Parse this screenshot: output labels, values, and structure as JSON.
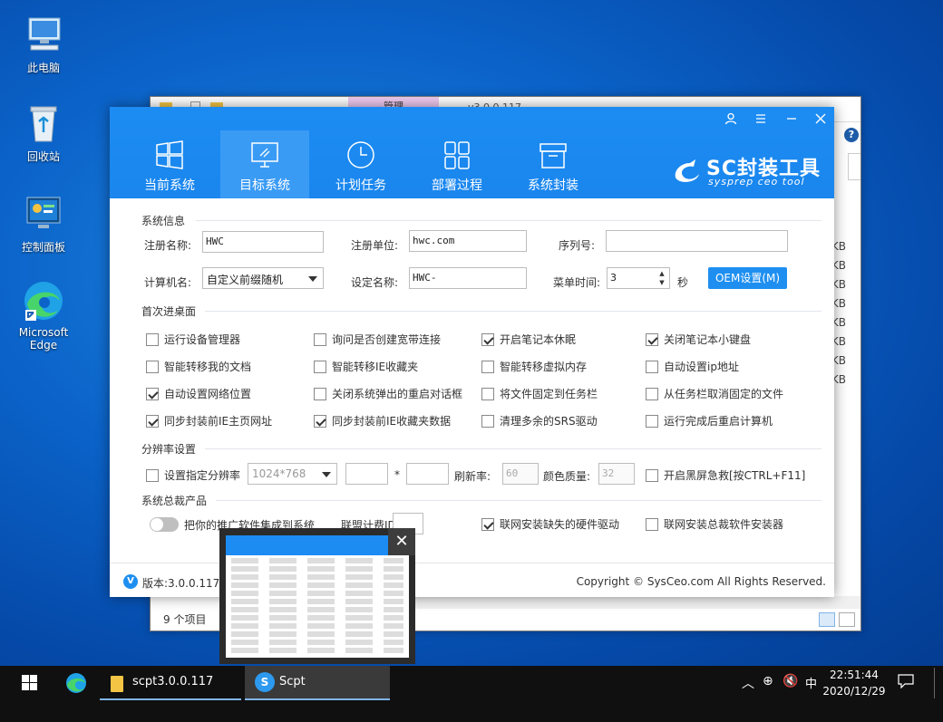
{
  "desktop": {
    "icons": [
      {
        "label": "此电脑"
      },
      {
        "label": "回收站"
      },
      {
        "label": "控制面板"
      },
      {
        "label": "Microsoft Edge"
      }
    ]
  },
  "explorer": {
    "manage_tab": "管理",
    "version": "v3.0.0.117",
    "help": "?",
    "size_unit": "KB",
    "status": "9 个项目"
  },
  "app": {
    "tabs": [
      {
        "label": "当前系统",
        "icon": "windows-logo-icon"
      },
      {
        "label": "目标系统",
        "icon": "monitor-icon",
        "active": true
      },
      {
        "label": "计划任务",
        "icon": "clock-icon"
      },
      {
        "label": "部署过程",
        "icon": "grid-icon"
      },
      {
        "label": "系统封装",
        "icon": "package-icon"
      }
    ],
    "brand": {
      "title": "SC封装工具",
      "subtitle": "sysprep ceo tool"
    },
    "sections": {
      "system_info": "系统信息",
      "first_desktop": "首次进桌面",
      "resolution": "分辨率设置",
      "products": "系统总裁产品"
    },
    "system_info": {
      "reg_name_label": "注册名称:",
      "reg_name_value": "HWC",
      "reg_org_label": "注册单位:",
      "reg_org_value": "hwc.com",
      "serial_label": "序列号:",
      "serial_value": "",
      "computer_name_label": "计算机名:",
      "computer_name_value": "自定义前缀随机",
      "set_name_label": "设定名称:",
      "set_name_value": "HWC-",
      "menu_time_label": "菜单时间:",
      "menu_time_value": "3",
      "menu_time_unit": "秒",
      "oem_button": "OEM设置(M)"
    },
    "first_desktop_options": [
      {
        "label": "运行设备管理器",
        "checked": false
      },
      {
        "label": "询问是否创建宽带连接",
        "checked": false
      },
      {
        "label": "开启笔记本休眠",
        "checked": true
      },
      {
        "label": "关闭笔记本小键盘",
        "checked": true
      },
      {
        "label": "智能转移我的文档",
        "checked": false
      },
      {
        "label": "智能转移IE收藏夹",
        "checked": false
      },
      {
        "label": "智能转移虚拟内存",
        "checked": false
      },
      {
        "label": "自动设置ip地址",
        "checked": false
      },
      {
        "label": "自动设置网络位置",
        "checked": true
      },
      {
        "label": "关闭系统弹出的重启对话框",
        "checked": false
      },
      {
        "label": "将文件固定到任务栏",
        "checked": false
      },
      {
        "label": "从任务栏取消固定的文件",
        "checked": false
      },
      {
        "label": "同步封装前IE主页网址",
        "checked": true
      },
      {
        "label": "同步封装前IE收藏夹数据",
        "checked": true
      },
      {
        "label": "清理多余的SRS驱动",
        "checked": false
      },
      {
        "label": "运行完成后重启计算机",
        "checked": false
      }
    ],
    "resolution": {
      "set_label": "设置指定分辨率",
      "set_checked": false,
      "resolution_value": "1024*768",
      "times": "*",
      "refresh_label": "刷新率:",
      "refresh_value": "60",
      "color_label": "颜色质量:",
      "color_value": "32",
      "blackscreen_label": "开启黑屏急救[按CTRL+F11]",
      "blackscreen_checked": false
    },
    "products": {
      "promo_label": "把你的推广软件集成到系统",
      "promo_on": false,
      "union_id_label": "联盟计费ID:",
      "union_id_value": "",
      "online_driver_label": "联网安装缺失的硬件驱动",
      "online_driver_checked": true,
      "online_installer_label": "联网安装总裁软件安装器",
      "online_installer_checked": false
    },
    "footer": {
      "version": "版本:3.0.0.117 [M",
      "copyright": "Copyright © SysCeo.com All Rights Reserved."
    }
  },
  "thumb": {
    "close": "✕"
  },
  "taskbar": {
    "items": [
      {
        "label": "scpt3.0.0.117"
      },
      {
        "label": "Scpt"
      }
    ],
    "ime": "中",
    "time": "22:51:44",
    "date": "2020/12/29"
  }
}
